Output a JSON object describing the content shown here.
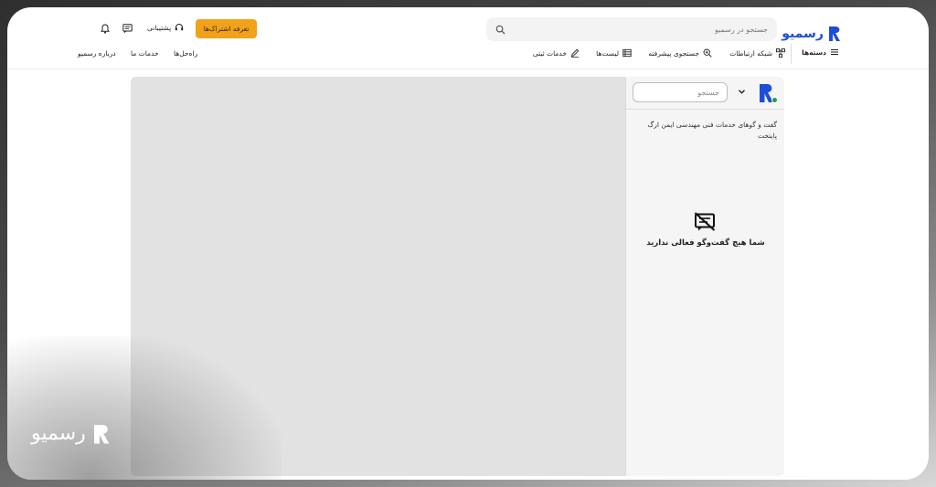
{
  "brand": {
    "name": "رسمیو",
    "color": "#1d4ed8"
  },
  "header": {
    "search_placeholder": "جستجو در رسمیو",
    "pricing_label": "تعرفه اشتراک‌ها",
    "support_label": "پشتیبانی"
  },
  "nav": {
    "categories_label": "دسته‌ها",
    "items": [
      {
        "label": "شبکه ارتباطات",
        "icon": "network-icon"
      },
      {
        "label": "جستجوی پیشرفته",
        "icon": "zoom-search-icon"
      },
      {
        "label": "لیست‌ها",
        "icon": "list-icon"
      },
      {
        "label": "خدمات ثبتی",
        "icon": "pen-icon"
      }
    ],
    "links": [
      {
        "label": "راه‌حل‌ها"
      },
      {
        "label": "خدمات ما"
      },
      {
        "label": "درباره رسمیو"
      }
    ]
  },
  "chat": {
    "search_placeholder": "جستجو",
    "group_title": "گفت و گوهای خدمات فنی مهندسی ایمن ارگ پایتخت",
    "empty_message": "شما هیچ گفت‌وگو فعالی ندارید"
  },
  "watermark": {
    "text": "رسمیو"
  },
  "colors": {
    "accent": "#f0a21b",
    "online": "#1e9e4a"
  }
}
